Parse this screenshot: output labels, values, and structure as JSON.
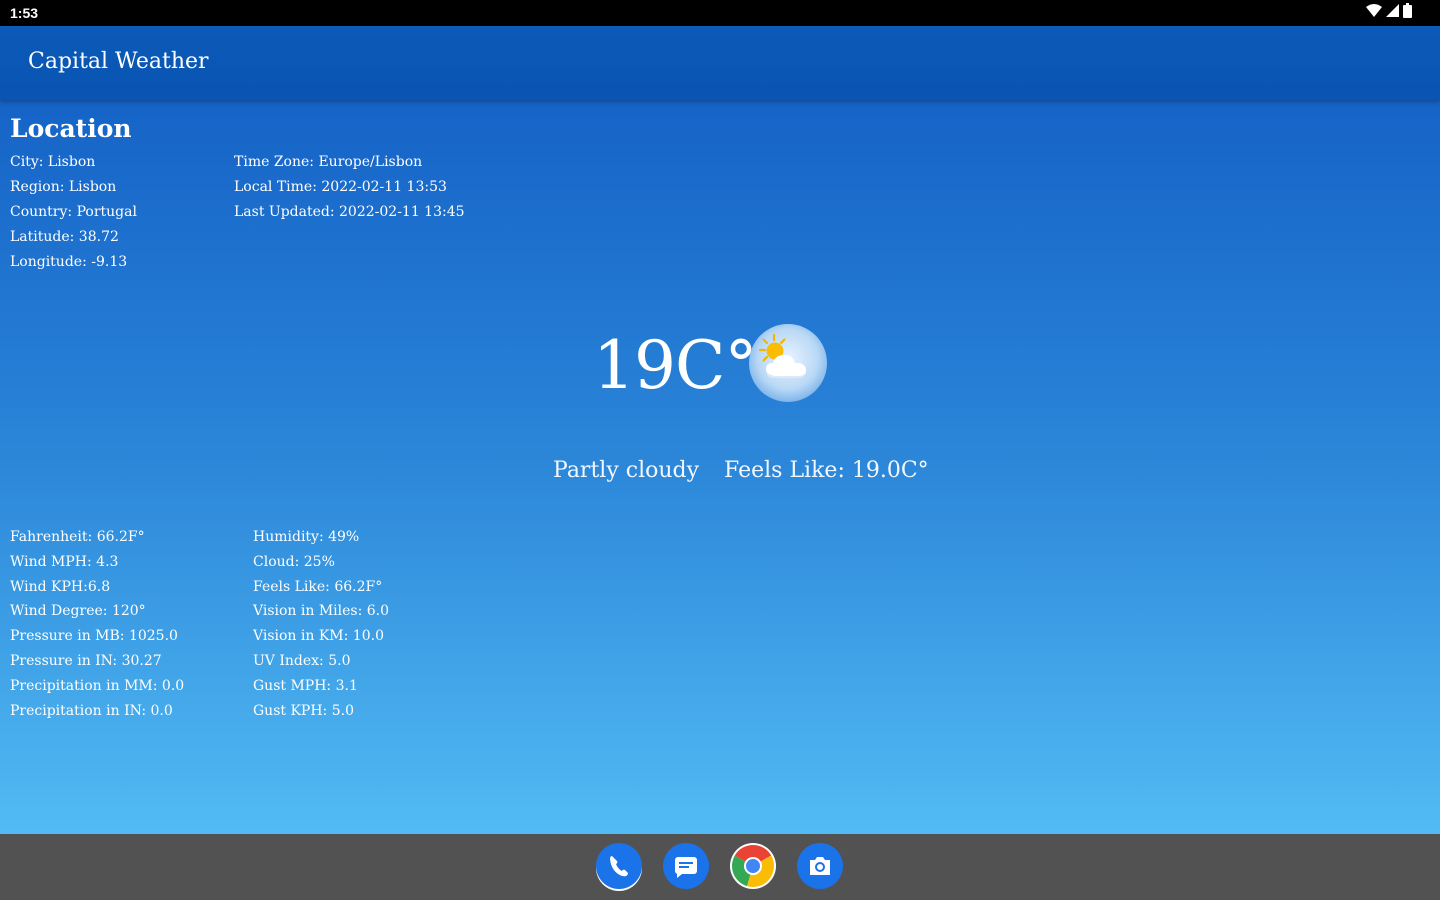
{
  "status_bar": {
    "time": "1:53",
    "icons": [
      "wifi-icon",
      "signal-icon",
      "battery-icon"
    ]
  },
  "app_bar": {
    "title": "Capital Weather",
    "color": "#0a55b4"
  },
  "location": {
    "heading": "Location",
    "left": [
      "City: Lisbon",
      "Region: Lisbon",
      "Country: Portugal",
      "Latitude: 38.72",
      "Longitude: -9.13"
    ],
    "right": [
      "Time Zone: Europe/Lisbon",
      "Local Time: 2022-02-11 13:53",
      "Last Updated: 2022-02-11 13:45"
    ]
  },
  "current": {
    "temperature": "19C°",
    "icon": "partly-cloudy-icon",
    "condition": "Partly cloudy",
    "feels_like": "Feels Like: 19.0C°"
  },
  "stats": {
    "left": [
      "Fahrenheit: 66.2F°",
      "Wind MPH: 4.3",
      "Wind KPH:6.8",
      "Wind Degree: 120°",
      "Pressure in MB: 1025.0",
      "Pressure in IN: 30.27",
      "Precipitation in MM: 0.0",
      "Precipitation in IN: 0.0"
    ],
    "right": [
      "Humidity: 49%",
      "Cloud: 25%",
      "Feels Like: 66.2F°",
      "Vision in Miles: 6.0",
      "Vision in KM: 10.0",
      "UV Index: 5.0",
      "Gust MPH: 3.1",
      "Gust KPH: 5.0"
    ]
  },
  "dock": {
    "apps": [
      "phone-icon",
      "messages-icon",
      "chrome-icon",
      "camera-icon"
    ],
    "colors": {
      "phone": "#1a73e8",
      "messages": "#1a73e8",
      "camera": "#1a73e8",
      "nav_background": "#525252"
    }
  }
}
